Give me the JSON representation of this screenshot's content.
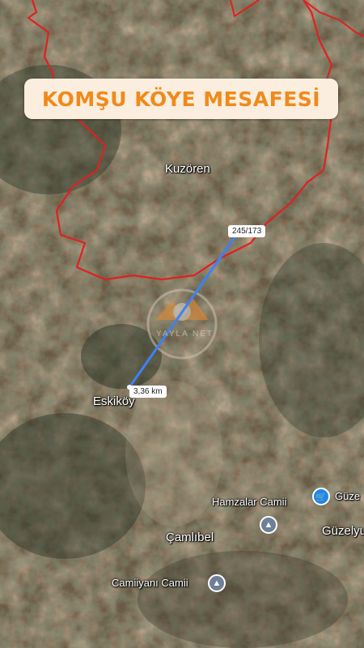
{
  "banner": {
    "title": "KOMŞU KÖYE MESAFESİ"
  },
  "places": {
    "kuzoren": "Kuzören",
    "eskikoy": "Eskiköy",
    "camlibel": "Çamlıbel",
    "guzelyurt": "Güzelyur",
    "hamzalar_camii": "Hamzalar Camii",
    "camiiyani_camii": "Camiiyanı Camii",
    "guzel_shop": "Güze"
  },
  "measure": {
    "top_label": "245/173",
    "distance_label": "3,36 km"
  },
  "watermark": {
    "text": "YAYLA NET"
  },
  "colors": {
    "boundary": "#e02020",
    "measure_line": "#3b82f6",
    "banner_text": "#f08a1c",
    "banner_bg": "#fbeede"
  },
  "icons": {
    "mosque": "mosque-pin-icon",
    "shop": "shopping-pin-icon"
  }
}
